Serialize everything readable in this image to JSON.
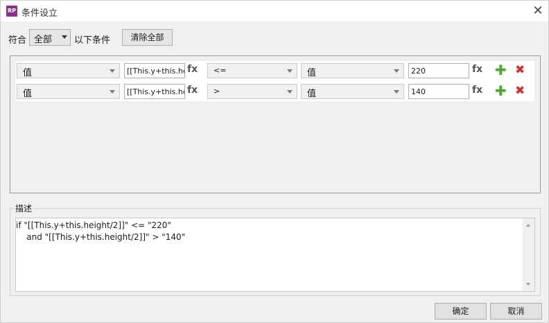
{
  "window": {
    "title": "条件设立",
    "app_icon_text": "RP"
  },
  "match": {
    "label": "符合",
    "selected": "全部",
    "suffix": "以下条件",
    "clear_label": "清除全部"
  },
  "conditions": [
    {
      "left_type": "值",
      "expression": "[[This.y+this.heig",
      "operator": "<=",
      "right_type": "值",
      "value": "220"
    },
    {
      "left_type": "值",
      "expression": "[[This.y+this.heig",
      "operator": ">",
      "right_type": "值",
      "value": "140"
    }
  ],
  "fx_label": "fx",
  "description": {
    "label": "描述",
    "line1": "if \"[[This.y+this.height/2]]\" <= \"220\"",
    "line2": "    and \"[[This.y+this.height/2]]\" > \"140\""
  },
  "buttons": {
    "ok": "确定",
    "cancel": "取消"
  },
  "colors": {
    "add": "#4fa82b",
    "delete": "#d0312d",
    "app_icon": "#8e2f8a"
  }
}
